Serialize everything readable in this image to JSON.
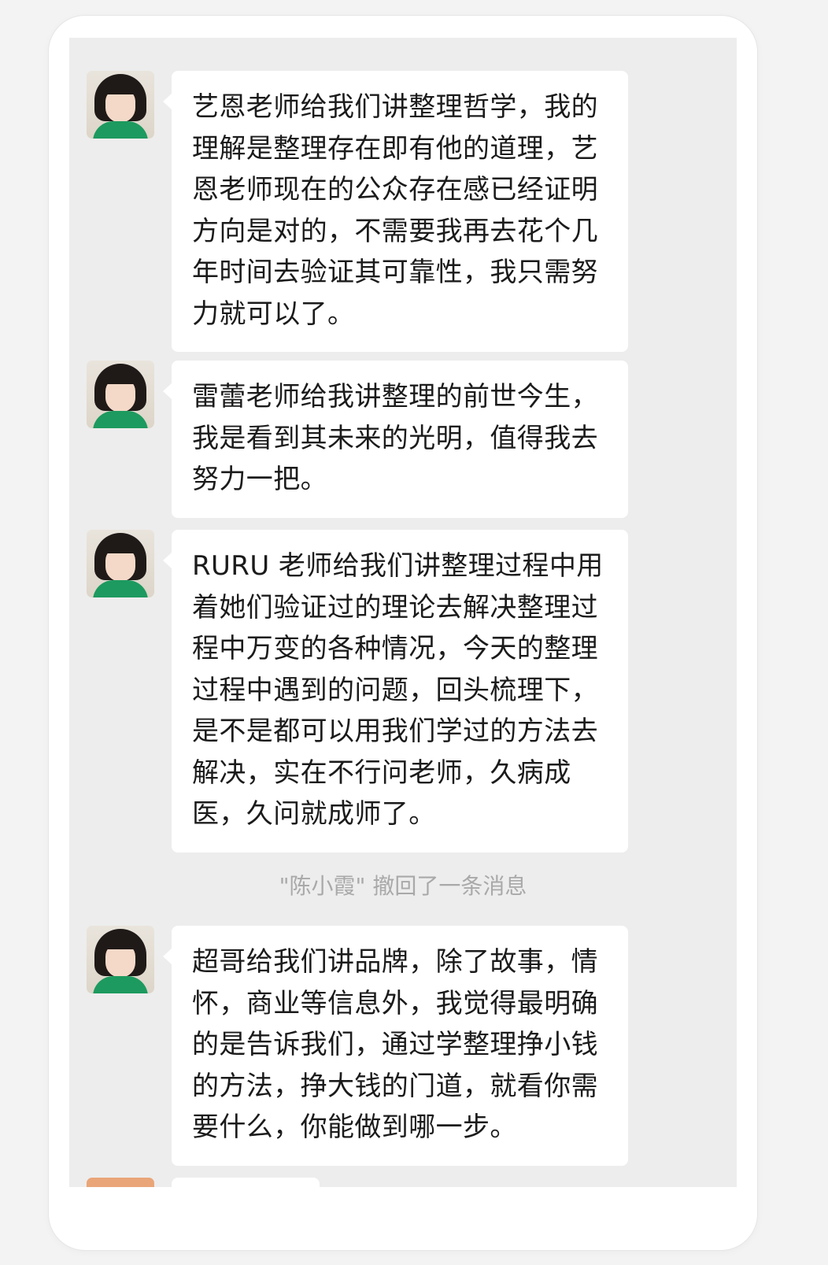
{
  "messages": [
    {
      "text": "艺恩老师给我们讲整理哲学，我的理解是整理存在即有他的道理，艺恩老师现在的公众存在感已经证明方向是对的，不需要我再去花个几年时间去验证其可靠性，我只需努力就可以了。"
    },
    {
      "text": "雷蕾老师给我讲整理的前世今生，我是看到其未来的光明，值得我去努力一把。"
    },
    {
      "text": "RURU 老师给我们讲整理过程中用着她们验证过的理论去解决整理过程中万变的各种情况，今天的整理过程中遇到的问题，回头梳理下，是不是都可以用我们学过的方法去解决，实在不行问老师，久病成医，久问就成师了。"
    },
    {
      "text": "超哥给我们讲品牌，除了故事，情怀，商业等信息外，我觉得最明确的是告诉我们，通过学整理挣小钱的方法，挣大钱的门道，就看你需要什么，你能做到哪一步。"
    }
  ],
  "system_notice": "\"陈小霞\" 撤回了一条消息"
}
